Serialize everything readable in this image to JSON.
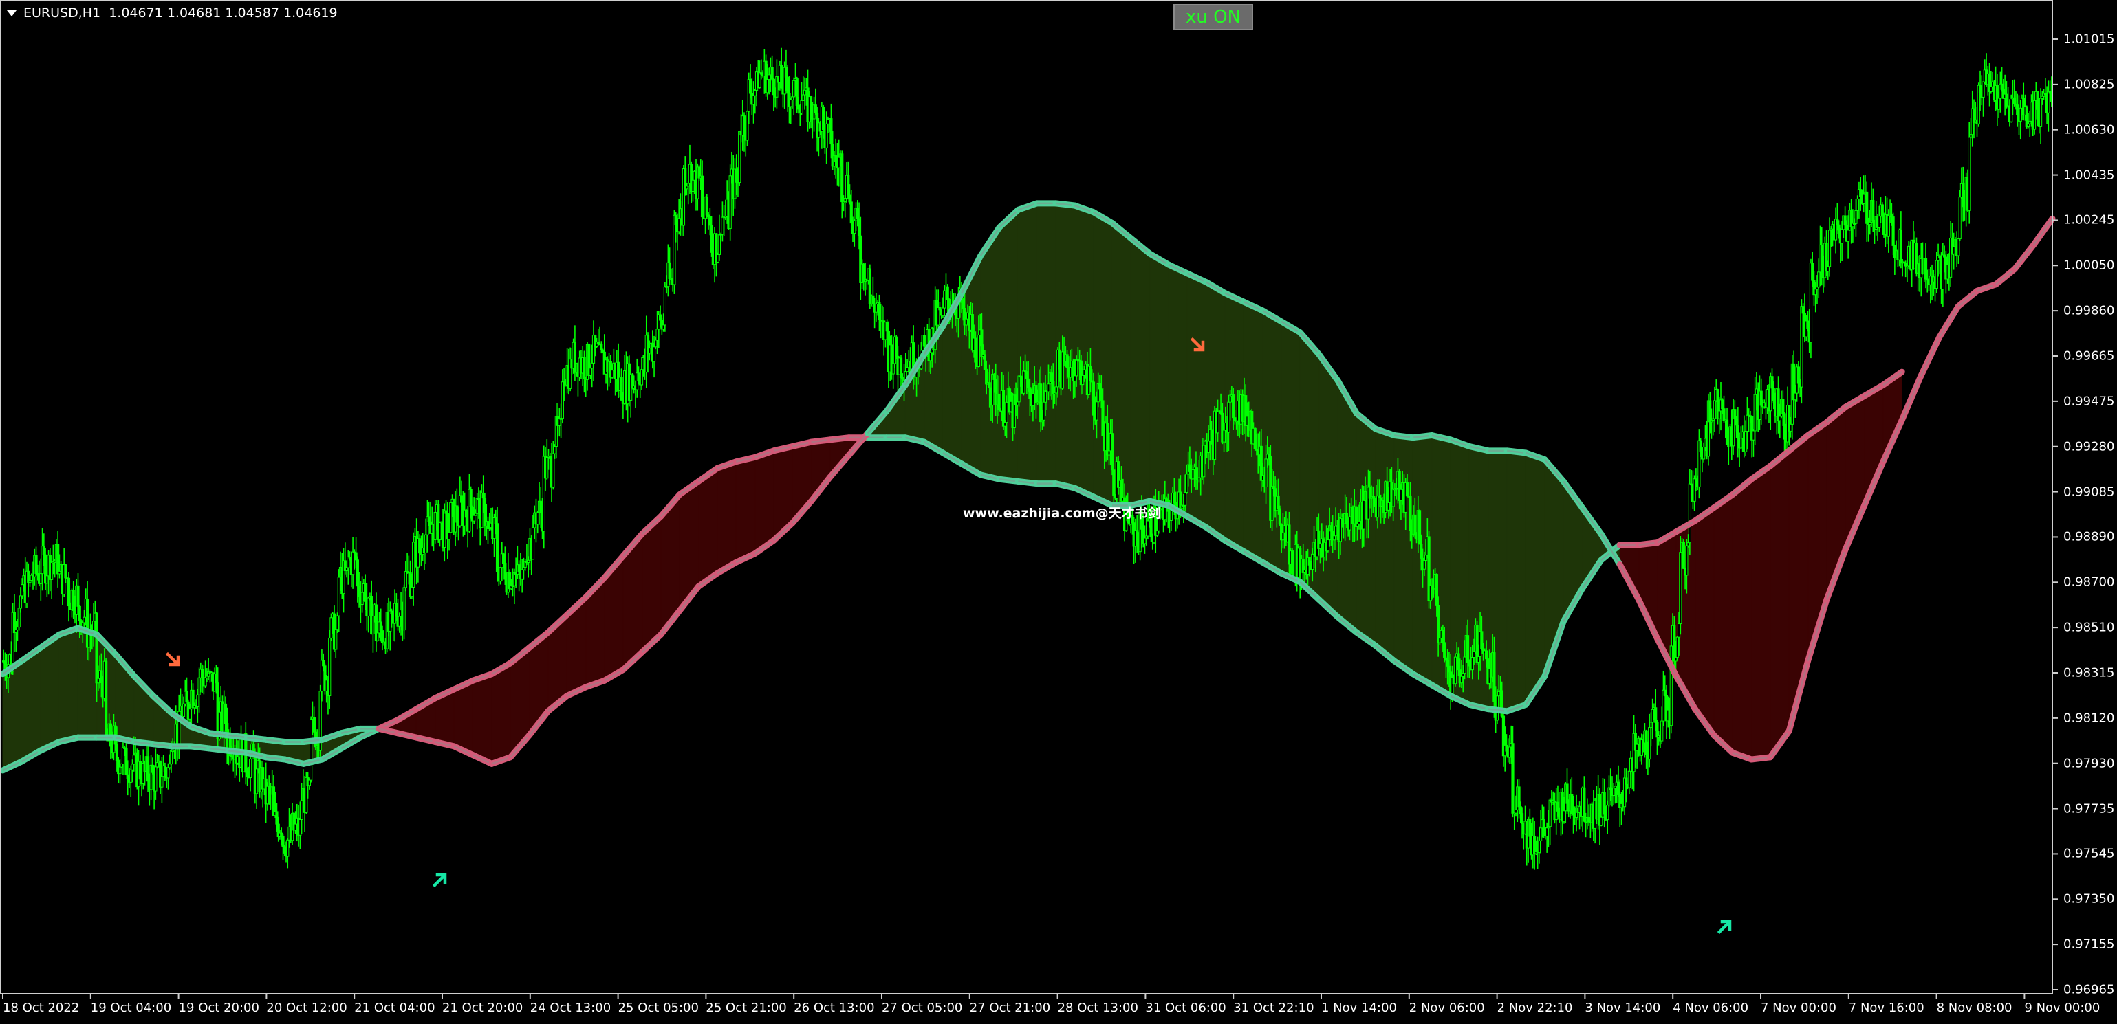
{
  "window": {
    "symbol_info": "EURUSD,H1  1.04671 1.04681 1.04587 1.04619",
    "button_label": "xu ON",
    "watermark": "www.eazhijia.com@天才书剑"
  },
  "colors": {
    "background": "#000000",
    "candles": "#00ff00",
    "fast_line": "#4fcf9a",
    "slow_line_down": "#d45a78",
    "fill_up": "#1e3508",
    "fill_down": "#3a0303",
    "arrow_down": "#ff6a3d",
    "arrow_up": "#16e8a6"
  },
  "chart_data": {
    "type": "line",
    "symbol": "EURUSD",
    "timeframe": "H1",
    "grid": false,
    "ylim": [
      0.96965,
      1.0111
    ],
    "y_ticks": [
      "1.01015",
      "1.00825",
      "1.00630",
      "1.00435",
      "1.00245",
      "1.00050",
      "0.99860",
      "0.99665",
      "0.99475",
      "0.99280",
      "0.99085",
      "0.98890",
      "0.98700",
      "0.98510",
      "0.98315",
      "0.98120",
      "0.97930",
      "0.97735",
      "0.97545",
      "0.97350",
      "0.97155",
      "0.96965"
    ],
    "x_ticks": [
      "18 Oct 2022",
      "19 Oct 04:00",
      "19 Oct 20:00",
      "20 Oct 12:00",
      "21 Oct 04:00",
      "21 Oct 20:00",
      "24 Oct 13:00",
      "25 Oct 05:00",
      "25 Oct 21:00",
      "26 Oct 13:00",
      "27 Oct 05:00",
      "27 Oct 21:00",
      "28 Oct 13:00",
      "31 Oct 06:00",
      "31 Oct 22:10",
      "1 Nov 14:00",
      "2 Nov 06:00",
      "2 Nov 22:10",
      "3 Nov 14:00",
      "4 Nov 06:00",
      "7 Nov 00:00",
      "7 Nov 16:00",
      "8 Nov 08:00",
      "9 Nov 00:00"
    ],
    "close_series": {
      "name": "close",
      "values": [
        0.9822,
        0.9843,
        0.9856,
        0.9862,
        0.9866,
        0.9868,
        0.986,
        0.9852,
        0.9843,
        0.9835,
        0.9813,
        0.9785,
        0.9778,
        0.9775,
        0.9772,
        0.977,
        0.9769,
        0.9772,
        0.979,
        0.98,
        0.9808,
        0.9815,
        0.9812,
        0.9795,
        0.9786,
        0.978,
        0.9776,
        0.9768,
        0.976,
        0.9748,
        0.974,
        0.9745,
        0.976,
        0.979,
        0.9815,
        0.9835,
        0.986,
        0.9868,
        0.9855,
        0.9843,
        0.9835,
        0.9836,
        0.9845,
        0.986,
        0.9872,
        0.988,
        0.9885,
        0.9882,
        0.9888,
        0.989,
        0.9893,
        0.989,
        0.988,
        0.9865,
        0.9862,
        0.986,
        0.9875,
        0.989,
        0.991,
        0.9925,
        0.9955,
        0.996,
        0.9958,
        0.9962,
        0.9958,
        0.9955,
        0.9948,
        0.995,
        0.9955,
        0.9965,
        0.9975,
        0.9995,
        1.0025,
        1.0045,
        1.004,
        1.0025,
        1.0012,
        1.0025,
        1.004,
        1.0068,
        1.0083,
        1.009,
        1.0088,
        1.0085,
        1.0082,
        1.008,
        1.0075,
        1.007,
        1.0062,
        1.005,
        1.004,
        1.002,
        1.0002,
        0.9985,
        0.9972,
        0.9962,
        0.9958,
        0.996,
        0.9962,
        0.9968,
        0.9978,
        0.9987,
        0.9985,
        0.9975,
        0.9965,
        0.9955,
        0.9945,
        0.9938,
        0.9935,
        0.995,
        0.9945,
        0.994,
        0.9948,
        0.9955,
        0.9958,
        0.9956,
        0.995,
        0.994,
        0.9925,
        0.9905,
        0.9888,
        0.988,
        0.9882,
        0.9885,
        0.9888,
        0.9892,
        0.9898,
        0.9905,
        0.9912,
        0.9922,
        0.993,
        0.9935,
        0.9938,
        0.9935,
        0.9925,
        0.991,
        0.9895,
        0.988,
        0.9868,
        0.9865,
        0.987,
        0.9875,
        0.9878,
        0.9885,
        0.9888,
        0.989,
        0.9893,
        0.9896,
        0.9898,
        0.99,
        0.9896,
        0.9885,
        0.987,
        0.9855,
        0.983,
        0.9815,
        0.9818,
        0.9825,
        0.983,
        0.982,
        0.98,
        0.978,
        0.976,
        0.9745,
        0.974,
        0.9745,
        0.9752,
        0.9757,
        0.9758,
        0.9756,
        0.9754,
        0.9755,
        0.9758,
        0.976,
        0.977,
        0.978,
        0.9785,
        0.9793,
        0.98,
        0.983,
        0.987,
        0.99,
        0.992,
        0.994,
        0.9935,
        0.9928,
        0.9925,
        0.993,
        0.9938,
        0.9945,
        0.994,
        0.993,
        0.995,
        0.9975,
        0.9995,
        1.0005,
        1.0015,
        1.0018,
        1.0026,
        1.003,
        1.0028,
        1.0024,
        1.0019,
        1.0013,
        1.0008,
        1.0004,
        1.0002,
        1.0,
        1.0,
        1.001,
        1.0035,
        1.007,
        1.0085,
        1.0083,
        1.0079,
        1.0076,
        1.0074,
        1.0072,
        1.0075,
        1.008
      ]
    },
    "fast_ma": {
      "name": "fast",
      "values": [
        0.9816,
        0.9822,
        0.9828,
        0.9834,
        0.9837,
        0.9834,
        0.9825,
        0.9815,
        0.9806,
        0.9798,
        0.9792,
        0.9789,
        0.9788,
        0.9787,
        0.9786,
        0.9785,
        0.9785,
        0.9786,
        0.9789,
        0.9791,
        0.9791,
        0.9789,
        0.9787,
        0.9785,
        0.9783,
        0.9779,
        0.9775,
        0.9778,
        0.9788,
        0.9799,
        0.9806,
        0.981,
        0.9813,
        0.9818,
        0.9826,
        0.9834,
        0.9845,
        0.9856,
        0.9862,
        0.9867,
        0.9871,
        0.9877,
        0.9885,
        0.9895,
        0.9906,
        0.9916,
        0.9926,
        0.9936,
        0.9948,
        0.9962,
        0.9975,
        0.999,
        1.0007,
        1.002,
        1.0028,
        1.0031,
        1.0031,
        1.003,
        1.0027,
        1.0022,
        1.0015,
        1.0008,
        1.0003,
        0.9999,
        0.9995,
        0.999,
        0.9986,
        0.9982,
        0.9977,
        0.9972,
        0.9962,
        0.995,
        0.9935,
        0.9928,
        0.9925,
        0.9924,
        0.9925,
        0.9923,
        0.992,
        0.9918,
        0.9918,
        0.9917,
        0.9914,
        0.9904,
        0.9892,
        0.988,
        0.9866,
        0.985,
        0.9832,
        0.9815,
        0.98,
        0.9788,
        0.978,
        0.9777,
        0.9778,
        0.979,
        0.9822,
        0.985,
        0.9873,
        0.9893,
        0.9913,
        0.9932,
        0.9952,
        0.997,
        0.9984,
        0.9991,
        0.9994,
        1.0001,
        1.0012,
        1.0024
      ]
    },
    "slow_ma": {
      "name": "slow",
      "values": [
        0.9772,
        0.9776,
        0.9781,
        0.9785,
        0.9787,
        0.9787,
        0.9787,
        0.9785,
        0.9784,
        0.9783,
        0.9783,
        0.9782,
        0.9781,
        0.978,
        0.9778,
        0.9777,
        0.9775,
        0.9777,
        0.9782,
        0.9787,
        0.9791,
        0.9795,
        0.98,
        0.9805,
        0.9809,
        0.9813,
        0.9816,
        0.9821,
        0.9828,
        0.9835,
        0.9843,
        0.9851,
        0.986,
        0.987,
        0.988,
        0.9888,
        0.9898,
        0.9904,
        0.991,
        0.9913,
        0.9915,
        0.9918,
        0.992,
        0.9922,
        0.9923,
        0.9924,
        0.9924,
        0.9924,
        0.9924,
        0.9922,
        0.9917,
        0.9912,
        0.9907,
        0.9905,
        0.9904,
        0.9903,
        0.9903,
        0.9901,
        0.9897,
        0.9893,
        0.9893,
        0.9895,
        0.9893,
        0.9888,
        0.9883,
        0.9877,
        0.9872,
        0.9867,
        0.9862,
        0.9858,
        0.985,
        0.9842,
        0.9835,
        0.9829,
        0.9822,
        0.9816,
        0.9811,
        0.9806,
        0.9802,
        0.98,
        0.9799,
        0.9802,
        0.9815,
        0.984,
        0.9855,
        0.9868,
        0.9875,
        0.9875,
        0.9876,
        0.9881,
        0.9886,
        0.9892,
        0.9898,
        0.9905,
        0.9911,
        0.9918,
        0.9925,
        0.9931,
        0.9938,
        0.9943,
        0.9948,
        0.9954
      ]
    },
    "signals": [
      {
        "type": "sell"
      },
      {
        "type": "buy"
      },
      {
        "type": "sell"
      },
      {
        "type": "buy"
      }
    ]
  }
}
